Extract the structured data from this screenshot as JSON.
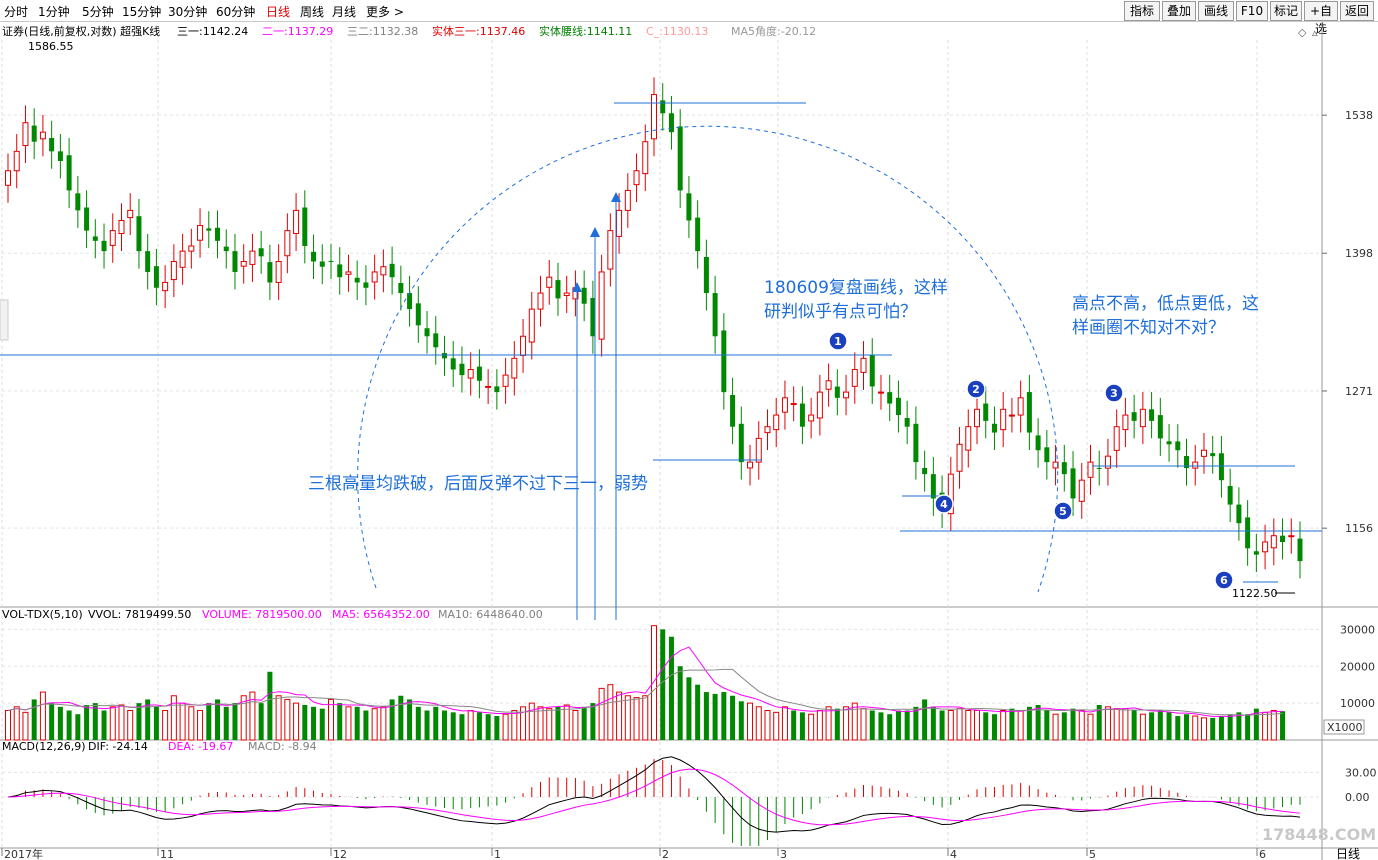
{
  "toolbar": {
    "timeframes": [
      "分时",
      "1分钟",
      "5分钟",
      "15分钟",
      "30分钟",
      "60分钟",
      "日线",
      "周线",
      "月线",
      "更多 >"
    ],
    "active": "日线",
    "buttons": [
      "指标",
      "叠加",
      "画线",
      "F10",
      "标记",
      "+自选",
      "返回"
    ]
  },
  "chart_data": [
    {
      "type": "candlestick",
      "title": "证券(日线,前复权,对数) 超强K线",
      "indicators": [
        {
          "label": "三一",
          "value": "1142.24",
          "color": "#000000"
        },
        {
          "label": "二一",
          "value": "1137.29",
          "color": "#ff00ff"
        },
        {
          "label": "三二",
          "value": "1132.38",
          "color": "#808080"
        },
        {
          "label": "实体三一",
          "value": "1137.46",
          "color": "#e00000"
        },
        {
          "label": "实体腰线",
          "value": "1141.11",
          "color": "#008000"
        },
        {
          "label": "C_",
          "value": "1130.13",
          "color": "#ff9999"
        },
        {
          "label": "MA5角度",
          "value": "-20.12",
          "color": "#999999"
        }
      ],
      "y_scale": "log",
      "yticks": [
        1538,
        1398,
        1271,
        1156
      ],
      "ylim": [
        1100,
        1620
      ],
      "x_labels": [
        "2017年",
        "11",
        "12",
        "1",
        "2",
        "3",
        "4",
        "5",
        "6"
      ],
      "right_label": "日线",
      "high_label": "1586.55",
      "low_label": "1122.50",
      "last_close": 1130.13,
      "annotations": [
        "180609复盘画线，这样",
        "研判似乎有点可怕？",
        "高点不高，低点更低，这",
        "样画圈不知对不对？",
        "三根高量均跌破，后面反弹不过下三一，弱势"
      ],
      "markers": [
        "1",
        "2",
        "3",
        "4",
        "5",
        "6"
      ],
      "closes": [
        1480,
        1500,
        1530,
        1510,
        1520,
        1500,
        1490,
        1460,
        1440,
        1420,
        1410,
        1400,
        1420,
        1430,
        1440,
        1400,
        1380,
        1365,
        1370,
        1390,
        1400,
        1405,
        1425,
        1420,
        1410,
        1400,
        1380,
        1390,
        1400,
        1395,
        1370,
        1390,
        1420,
        1440,
        1405,
        1390,
        1385,
        1390,
        1375,
        1380,
        1370,
        1365,
        1380,
        1385,
        1375,
        1360,
        1345,
        1330,
        1320,
        1310,
        1300,
        1290,
        1285,
        1290,
        1280,
        1275,
        1270,
        1285,
        1300,
        1320,
        1345,
        1360,
        1375,
        1355,
        1360,
        1365,
        1350,
        1320,
        1380,
        1420,
        1440,
        1460,
        1480,
        1510,
        1560,
        1540,
        1520,
        1460,
        1430,
        1400,
        1360,
        1320,
        1270,
        1240,
        1210,
        1210,
        1230,
        1240,
        1250,
        1265,
        1260,
        1240,
        1250,
        1270,
        1280,
        1265,
        1270,
        1290,
        1300,
        1275,
        1270,
        1260,
        1250,
        1240,
        1210,
        1200,
        1180,
        1170,
        1200,
        1225,
        1240,
        1255,
        1245,
        1235,
        1255,
        1250,
        1265,
        1235,
        1220,
        1210,
        1210,
        1200,
        1180,
        1195,
        1210,
        1205,
        1215,
        1240,
        1250,
        1245,
        1255,
        1245,
        1230,
        1225,
        1220,
        1205,
        1210,
        1220,
        1215,
        1195,
        1175,
        1160,
        1140,
        1135,
        1145,
        1150,
        1145,
        1150,
        1130
      ]
    },
    {
      "type": "bar",
      "title": "VOL-TDX(5,10)",
      "indicators": [
        {
          "label": "VVOL",
          "value": "7819499.50",
          "color": "#000000"
        },
        {
          "label": "VOLUME",
          "value": "7819500.00",
          "color": "#ff00ff"
        },
        {
          "label": "MA5",
          "value": "6564352.00",
          "color": "#ff00ff"
        },
        {
          "label": "MA10",
          "value": "6448640.00",
          "color": "#808080"
        }
      ],
      "yticks": [
        30000,
        20000,
        10000
      ],
      "unit": "X1000",
      "ylim": [
        0,
        32000
      ],
      "values": [
        8000,
        9000,
        7500,
        11000,
        13000,
        10000,
        9000,
        8000,
        7000,
        9500,
        10000,
        8000,
        9000,
        9500,
        8000,
        10000,
        11000,
        9000,
        8000,
        12000,
        10000,
        9000,
        8000,
        10000,
        11000,
        9000,
        10000,
        12000,
        13000,
        10000,
        18500,
        12000,
        11000,
        10000,
        9500,
        9000,
        8500,
        11000,
        10000,
        9000,
        9000,
        8000,
        8500,
        9000,
        11000,
        12000,
        11000,
        9000,
        8000,
        9000,
        8000,
        7500,
        7000,
        8000,
        7500,
        7000,
        6500,
        7000,
        8000,
        9000,
        10000,
        9000,
        8500,
        9000,
        9500,
        8000,
        9000,
        10000,
        14000,
        15000,
        13000,
        12000,
        11500,
        12000,
        31000,
        30000,
        28000,
        20000,
        17000,
        15000,
        13000,
        12500,
        13000,
        12000,
        10500,
        10000,
        9000,
        8000,
        7500,
        9000,
        8000,
        7500,
        7000,
        8000,
        9000,
        8500,
        9000,
        10000,
        8500,
        8000,
        7500,
        7000,
        8000,
        8000,
        9000,
        11000,
        9000,
        8000,
        8000,
        8500,
        8000,
        8000,
        7500,
        7000,
        8000,
        8500,
        8000,
        9000,
        9500,
        8000,
        7000,
        7500,
        8500,
        8000,
        7000,
        9500,
        9000,
        8500,
        8500,
        8000,
        7000,
        7500,
        8000,
        7500,
        6500,
        7000,
        6500,
        6000,
        6000,
        6500,
        7000,
        7500,
        7000,
        8500,
        7500,
        8000,
        7819
      ]
    },
    {
      "type": "macd",
      "title": "MACD(12,26,9)",
      "indicators": [
        {
          "label": "DIF",
          "value": "-24.14",
          "color": "#000000"
        },
        {
          "label": "DEA",
          "value": "-19.67",
          "color": "#ff00ff"
        },
        {
          "label": "MACD",
          "value": "-8.94",
          "color": "#808080"
        }
      ],
      "yticks": [
        30.0,
        0.0
      ],
      "ylim": [
        -60,
        55
      ]
    }
  ],
  "watermark": "178448.COM"
}
